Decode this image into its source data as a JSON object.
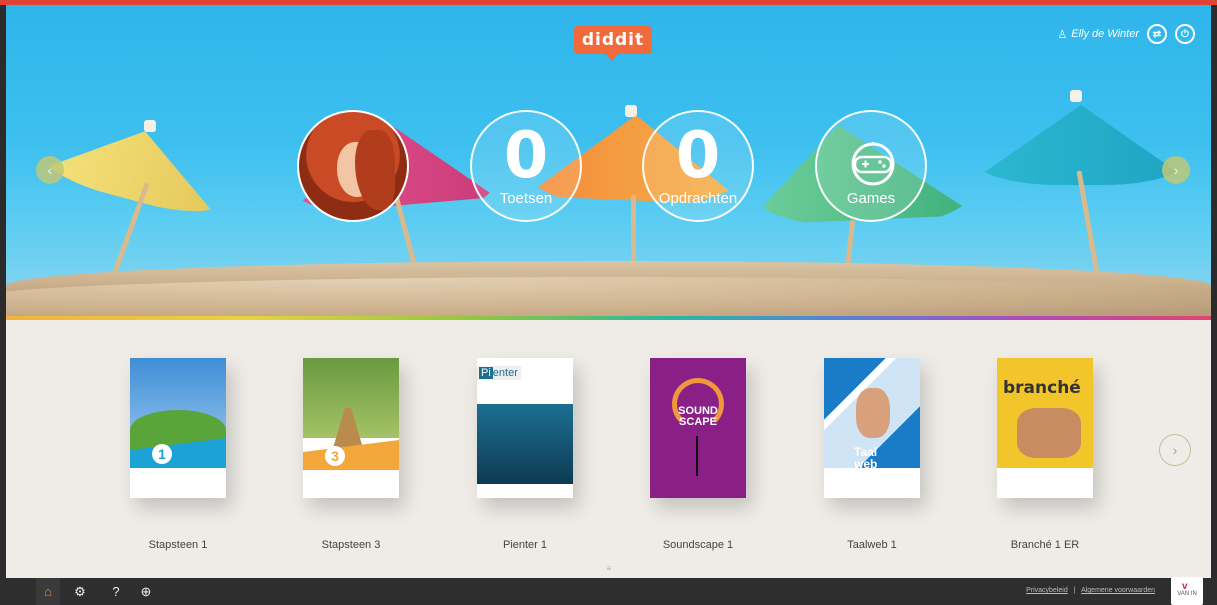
{
  "app": {
    "logo": "diddit"
  },
  "user": {
    "name": "Elly de Winter",
    "icons": [
      "user-icon",
      "switch-icon",
      "logout-icon"
    ]
  },
  "hero": {
    "stats": [
      {
        "value": "0",
        "label": "Toetsen"
      },
      {
        "value": "0",
        "label": "Opdrachten"
      }
    ],
    "games_label": "Games"
  },
  "books": [
    {
      "title": "Stapsteen 1",
      "cover_color": "#1aa3d4"
    },
    {
      "title": "Stapsteen 3",
      "cover_color": "#f3a73a"
    },
    {
      "title": "Pienter 1",
      "cover_color": "#1d6f93",
      "cover_text": "Pienter"
    },
    {
      "title": "Soundscape 1",
      "cover_color": "#8a1f86",
      "cover_text": "SOUND SCAPE"
    },
    {
      "title": "Taalweb 1",
      "cover_color": "#1a7bc6",
      "cover_text": "Taal web"
    },
    {
      "title": "Branché 1 ER",
      "cover_color": "#f2c52a",
      "cover_text": "branché"
    }
  ],
  "footer": {
    "privacy": "Privacybeleid",
    "terms": "Algemene voorwaarden",
    "publisher": "VAN IN",
    "nav_icons": [
      "home-icon",
      "settings-icon",
      "help-icon",
      "add-icon"
    ]
  },
  "colors": {
    "accent": "#f06a3b",
    "top_line": "#e04436"
  }
}
